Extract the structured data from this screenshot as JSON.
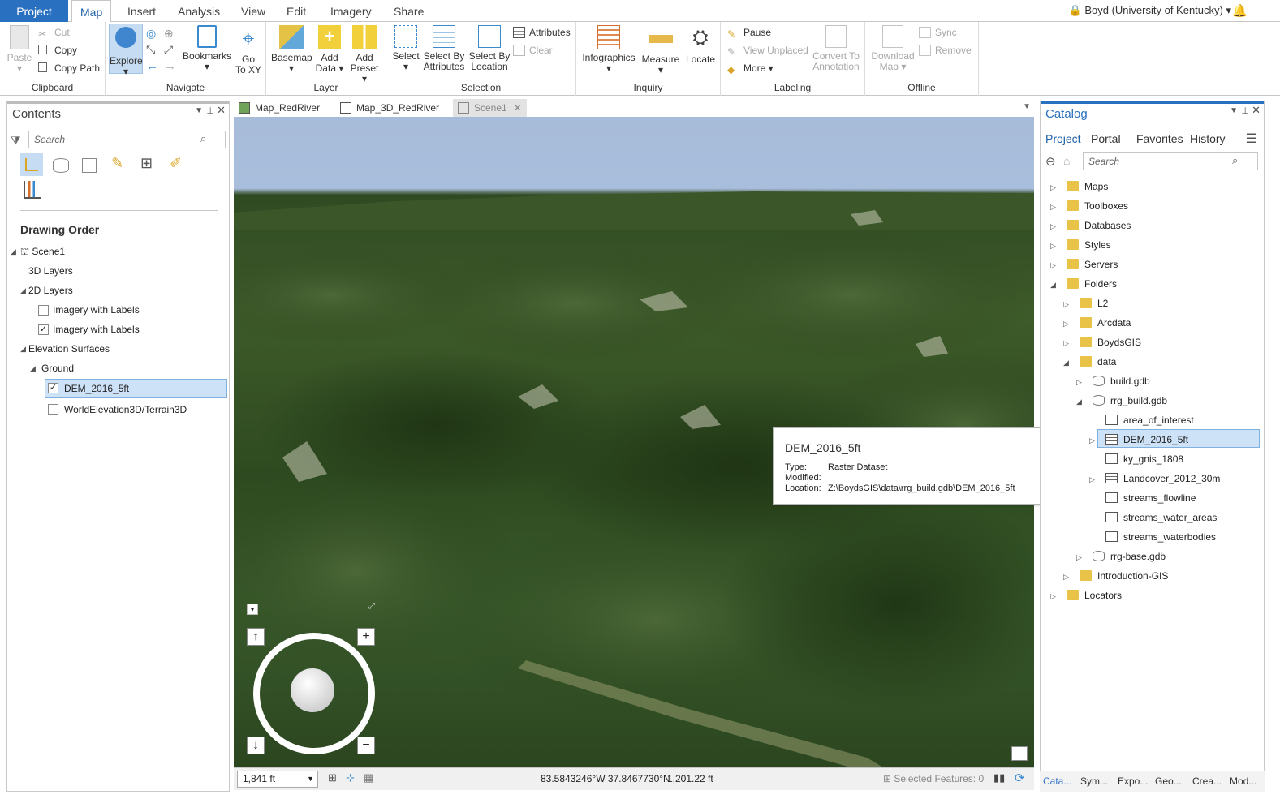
{
  "ribbon_tabs": [
    "Project",
    "Map",
    "Insert",
    "Analysis",
    "View",
    "Edit",
    "Imagery",
    "Share"
  ],
  "user": "Boyd (University of Kentucky)",
  "groups": {
    "clipboard": "Clipboard",
    "navigate": "Navigate",
    "layer": "Layer",
    "selection": "Selection",
    "inquiry": "Inquiry",
    "labeling": "Labeling",
    "offline": "Offline"
  },
  "buttons": {
    "paste": "Paste",
    "cut": "Cut",
    "copy": "Copy",
    "copy_path": "Copy Path",
    "explore": "Explore",
    "bookmarks": "Bookmarks",
    "go_to_xy_1": "Go",
    "go_to_xy_2": "To XY",
    "basemap": "Basemap",
    "add_data_1": "Add",
    "add_data_2": "Data",
    "add_preset_1": "Add",
    "add_preset_2": "Preset",
    "select": "Select",
    "sel_attr_1": "Select By",
    "sel_attr_2": "Attributes",
    "sel_loc_1": "Select By",
    "sel_loc_2": "Location",
    "attributes": "Attributes",
    "clear": "Clear",
    "infographics": "Infographics",
    "measure": "Measure",
    "locate": "Locate",
    "pause": "Pause",
    "view_unplaced": "View Unplaced",
    "more": "More",
    "convert_1": "Convert To",
    "convert_2": "Annotation",
    "download_1": "Download",
    "download_2": "Map",
    "sync": "Sync",
    "remove": "Remove"
  },
  "contents": {
    "title": "Contents",
    "search_placeholder": "Search",
    "drawing_order": "Drawing Order",
    "scene": "Scene1",
    "layers_3d": "3D Layers",
    "layers_2d": "2D Layers",
    "imagery1": "Imagery with Labels",
    "imagery2": "Imagery with Labels",
    "elevation": "Elevation Surfaces",
    "ground": "Ground",
    "dem": "DEM_2016_5ft",
    "world": "WorldElevation3D/Terrain3D"
  },
  "map_tabs": [
    "Map_RedRiver",
    "Map_3D_RedRiver",
    "Scene1"
  ],
  "status": {
    "scale": "1,841 ft",
    "coords": "83.5843246°W 37.8467730°N",
    "elev": "1,201.22 ft",
    "selected": "Selected Features: 0"
  },
  "tooltip": {
    "title": "DEM_2016_5ft",
    "type_label": "Type:",
    "type_value": "Raster Dataset",
    "modified_label": "Modified:",
    "location_label": "Location:",
    "location_value": "Z:\\BoydsGIS\\data\\rrg_build.gdb\\DEM_2016_5ft"
  },
  "catalog": {
    "title": "Catalog",
    "tabs": [
      "Project",
      "Portal",
      "Favorites",
      "History"
    ],
    "search_placeholder": "Search",
    "items": [
      "Maps",
      "Toolboxes",
      "Databases",
      "Styles",
      "Servers",
      "Folders",
      "L2",
      "Arcdata",
      "BoydsGIS",
      "data",
      "build.gdb",
      "rrg_build.gdb",
      "area_of_interest",
      "DEM_2016_5ft",
      "ky_gnis_1808",
      "Landcover_2012_30m",
      "streams_flowline",
      "streams_water_areas",
      "streams_waterbodies",
      "rrg-base.gdb",
      "Introduction-GIS",
      "Locators"
    ]
  },
  "bottom_tabs": [
    "Cata...",
    "Sym...",
    "Expo...",
    "Geo...",
    "Crea...",
    "Mod..."
  ],
  "colors": {
    "accent": "#2a70c1",
    "selection": "#cde2f7"
  }
}
